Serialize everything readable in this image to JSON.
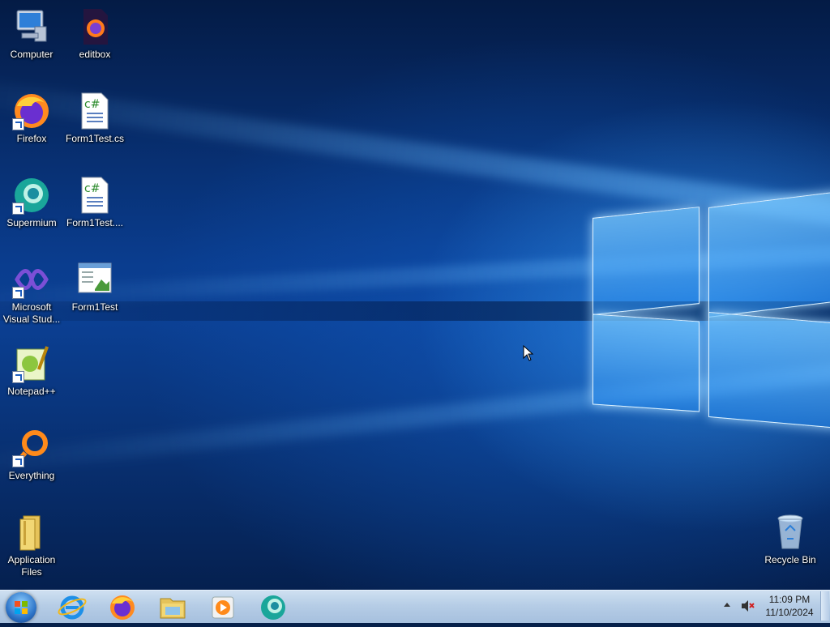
{
  "desktop": {
    "icons": [
      {
        "label": "Computer"
      },
      {
        "label": "editbox"
      },
      {
        "label": "Firefox"
      },
      {
        "label": "Form1Test.cs"
      },
      {
        "label": "Supermium"
      },
      {
        "label": "Form1Test...."
      },
      {
        "label": "Microsoft\nVisual Stud..."
      },
      {
        "label": "Form1Test"
      },
      {
        "label": "Notepad++"
      },
      {
        "label": "Everything"
      },
      {
        "label": "Application\nFiles"
      },
      {
        "label": "Recycle Bin"
      }
    ]
  },
  "taskbar": {
    "clock_time": "11:09 PM",
    "clock_date": "11/10/2024"
  },
  "colors": {
    "accent": "#1e6fd6",
    "taskbar": "#b6cde6"
  }
}
